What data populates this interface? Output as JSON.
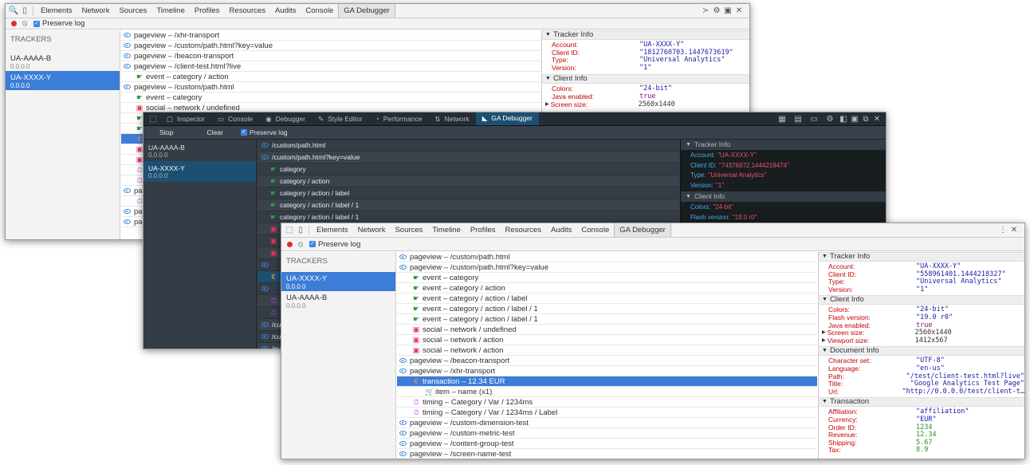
{
  "w1": {
    "tabs": [
      "Elements",
      "Network",
      "Sources",
      "Timeline",
      "Profiles",
      "Resources",
      "Audits",
      "Console",
      "GA Debugger"
    ],
    "preserve_log": "Preserve log",
    "trackers_header": "TRACKERS",
    "trackers": [
      {
        "name": "UA-AAAA-B",
        "version": "0.0.0.0"
      },
      {
        "name": "UA-XXXX-Y",
        "version": "0.0.0.0"
      }
    ],
    "hits": [
      {
        "t": "pageview",
        "label": "pageview – /xhr-transport"
      },
      {
        "t": "pageview",
        "label": "pageview – /custom/path.html?key=value"
      },
      {
        "t": "pageview",
        "label": "pageview – /beacon-transport"
      },
      {
        "t": "pageview",
        "label": "pageview – /client-test.html?live"
      },
      {
        "t": "event",
        "label": "event – category / action"
      },
      {
        "t": "pageview",
        "label": "pageview – /custom/path.html"
      },
      {
        "t": "event",
        "label": "event – category"
      },
      {
        "t": "social",
        "label": "social – network / undefined"
      },
      {
        "t": "event",
        "label": "ev"
      },
      {
        "t": "event",
        "label": "ev"
      },
      {
        "t": "transaction",
        "label": "tr"
      },
      {
        "t": "social",
        "label": "so"
      },
      {
        "t": "social",
        "label": "so"
      },
      {
        "t": "timing",
        "label": "ti"
      },
      {
        "t": "timing",
        "label": "ti"
      },
      {
        "t": "pageview",
        "label": "pa"
      },
      {
        "t": "timing",
        "label": "ti"
      },
      {
        "t": "pageview",
        "label": "pa"
      },
      {
        "t": "pageview",
        "label": "pa"
      }
    ],
    "tracker_info_title": "Tracker Info",
    "tracker_info": [
      {
        "k": "Account:",
        "v": "\"UA-XXXX-Y\"",
        "c": "str"
      },
      {
        "k": "Client ID:",
        "v": "\"1812760703.1447673619\"",
        "c": "str"
      },
      {
        "k": "Type:",
        "v": "\"Universal Analytics\"",
        "c": "str"
      },
      {
        "k": "Version:",
        "v": "\"1\"",
        "c": "str"
      }
    ],
    "client_info_title": "Client Info",
    "client_info": [
      {
        "k": "Colors:",
        "v": "\"24-bit\"",
        "c": "str"
      },
      {
        "k": "Java enabled:",
        "v": "true",
        "c": "p"
      },
      {
        "k": "Screen size:",
        "v": "2560x1440",
        "c": "plain"
      }
    ]
  },
  "w2": {
    "tabs": [
      "Inspector",
      "Console",
      "Debugger",
      "Style Editor",
      "Performance",
      "Network",
      "GA Debugger"
    ],
    "stop": "Stop",
    "clear": "Clear",
    "preserve_log": "Preserve log",
    "trackers": [
      {
        "name": "UA-AAAA-B",
        "version": "0.0.0.0"
      },
      {
        "name": "UA-XXXX-Y",
        "version": "0.0.0.0"
      }
    ],
    "hits": [
      {
        "t": "pageview",
        "label": "/custom/path.html"
      },
      {
        "t": "pageview",
        "label": "/custom/path.html?key=value"
      },
      {
        "t": "event",
        "label": "category"
      },
      {
        "t": "event",
        "label": "category / action"
      },
      {
        "t": "event",
        "label": "category / action / label"
      },
      {
        "t": "event",
        "label": "category / action / label / 1"
      },
      {
        "t": "event",
        "label": "category / action / label / 1"
      },
      {
        "t": "social",
        "label": ""
      },
      {
        "t": "social",
        "label": ""
      },
      {
        "t": "social",
        "label": ""
      },
      {
        "t": "pageview",
        "label": ""
      },
      {
        "t": "transaction",
        "label": ""
      },
      {
        "t": "pageview",
        "label": ""
      },
      {
        "t": "timing",
        "label": ""
      },
      {
        "t": "timing",
        "label": ""
      },
      {
        "t": "pageview",
        "label": "/cu"
      },
      {
        "t": "pageview",
        "label": "/cu"
      },
      {
        "t": "pageview",
        "label": "/cu"
      },
      {
        "t": "pageview",
        "label": "/cu"
      }
    ],
    "tracker_info_title": "Tracker Info",
    "tracker_info": [
      {
        "k": "Account:",
        "v": "\"UA-XXXX-Y\""
      },
      {
        "k": "Client ID:",
        "v": "\"74376972.1444218474\""
      },
      {
        "k": "Type:",
        "v": "\"Universal Analytics\""
      },
      {
        "k": "Version:",
        "v": "\"1\""
      }
    ],
    "client_info_title": "Client Info",
    "client_info": [
      {
        "k": "Colors:",
        "v": "\"24-bit\""
      },
      {
        "k": "Flash version:",
        "v": "\"19.0 r0\""
      }
    ]
  },
  "w3": {
    "tabs": [
      "Elements",
      "Network",
      "Sources",
      "Timeline",
      "Profiles",
      "Resources",
      "Audits",
      "Console",
      "GA Debugger"
    ],
    "preserve_log": "Preserve log",
    "trackers_header": "TRACKERS",
    "trackers": [
      {
        "name": "UA-XXXX-Y",
        "version": "0.0.0.0"
      },
      {
        "name": "UA-AAAA-B",
        "version": "0.0.0.0"
      }
    ],
    "hits": [
      {
        "t": "pageview",
        "label": "pageview – /custom/path.html",
        "ind": 0
      },
      {
        "t": "pageview",
        "label": "pageview – /custom/path.html?key=value",
        "ind": 0
      },
      {
        "t": "event",
        "label": "event – category",
        "ind": 1
      },
      {
        "t": "event",
        "label": "event – category / action",
        "ind": 1
      },
      {
        "t": "event",
        "label": "event – category / action / label",
        "ind": 1
      },
      {
        "t": "event",
        "label": "event – category / action / label / 1",
        "ind": 1
      },
      {
        "t": "event",
        "label": "event – category / action / label / 1",
        "ind": 1
      },
      {
        "t": "social",
        "label": "social – network / undefined",
        "ind": 1
      },
      {
        "t": "social",
        "label": "social – network / action",
        "ind": 1
      },
      {
        "t": "social",
        "label": "social – network / action",
        "ind": 1
      },
      {
        "t": "pageview",
        "label": "pageview – /beacon-transport",
        "ind": 0
      },
      {
        "t": "pageview",
        "label": "pageview – /xhr-transport",
        "ind": 0
      },
      {
        "t": "transaction",
        "label": "transaction – 12.34 EUR",
        "ind": 1
      },
      {
        "t": "item",
        "label": "item – name (x1)",
        "ind": 2
      },
      {
        "t": "timing",
        "label": "timing – Category / Var / 1234ms",
        "ind": 1
      },
      {
        "t": "timing",
        "label": "timing – Category / Var / 1234ms / Label",
        "ind": 1
      },
      {
        "t": "pageview",
        "label": "pageview – /custom-dimension-test",
        "ind": 0
      },
      {
        "t": "pageview",
        "label": "pageview – /custom-metric-test",
        "ind": 0
      },
      {
        "t": "pageview",
        "label": "pageview – /content-group-test",
        "ind": 0
      },
      {
        "t": "pageview",
        "label": "pageview – /screen-name-test",
        "ind": 0
      }
    ],
    "selected_hit": 12,
    "sections": [
      {
        "title": "Tracker Info",
        "rows": [
          {
            "k": "Account:",
            "v": "\"UA-XXXX-Y\"",
            "c": "str"
          },
          {
            "k": "Client ID:",
            "v": "\"558961401.1444218327\"",
            "c": "str"
          },
          {
            "k": "Type:",
            "v": "\"Universal Analytics\"",
            "c": "str"
          },
          {
            "k": "Version:",
            "v": "\"1\"",
            "c": "str"
          }
        ]
      },
      {
        "title": "Client Info",
        "rows": [
          {
            "k": "Colors:",
            "v": "\"24-bit\"",
            "c": "str"
          },
          {
            "k": "Flash version:",
            "v": "\"19.0 r0\"",
            "c": "str"
          },
          {
            "k": "Java enabled:",
            "v": "true",
            "c": "p"
          },
          {
            "k": "Screen size:",
            "v": "2560x1440",
            "c": "plain",
            "arrow": true
          },
          {
            "k": "Viewport size:",
            "v": "1412x567",
            "c": "plain",
            "arrow": true
          }
        ]
      },
      {
        "title": "Document Info",
        "rows": [
          {
            "k": "Character set:",
            "v": "\"UTF-8\"",
            "c": "str"
          },
          {
            "k": "Language:",
            "v": "\"en-us\"",
            "c": "str"
          },
          {
            "k": "Path:",
            "v": "\"/test/client-test.html?live\"",
            "c": "str"
          },
          {
            "k": "Title:",
            "v": "\"Google Analytics Test Page\"",
            "c": "str"
          },
          {
            "k": "Url:",
            "v": "\"http://0.0.0.0/test/client-t…",
            "c": "str"
          }
        ]
      },
      {
        "title": "Transaction",
        "rows": [
          {
            "k": "Affiliation:",
            "v": "\"affiliation\"",
            "c": "str"
          },
          {
            "k": "Currency:",
            "v": "\"EUR\"",
            "c": "str"
          },
          {
            "k": "Order ID:",
            "v": "1234",
            "c": "g"
          },
          {
            "k": "Revenue:",
            "v": "12.34",
            "c": "g"
          },
          {
            "k": "Shipping:",
            "v": "5.67",
            "c": "g"
          },
          {
            "k": "Tax:",
            "v": "8.9",
            "c": "g"
          }
        ]
      }
    ]
  }
}
